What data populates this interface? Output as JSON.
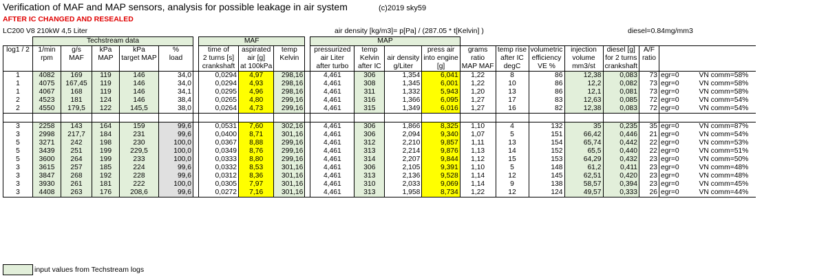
{
  "title": "Verification of MAF and MAP sensors, analysis for possible leakage in air system",
  "copyright": "(c)2019 sky59",
  "subtitle": "AFTER IC CHANGED AND RESEALED",
  "engine": "LC200 V8 210kW  4,5 Liter",
  "formula": "air density [kg/m3]= p[Pa] / (287.05 * t[Kelvin] )",
  "diesel_density": "diesel=0.84mg/mm3",
  "groups": {
    "techstream": "Techstream data",
    "maf": "MAF",
    "map": "MAP"
  },
  "headers_row1": [
    "log1 / 2",
    "1/min",
    "g/s",
    "kPa",
    "kPa",
    "%",
    "time of",
    "aspirated",
    "temp",
    "pressurized",
    "temp",
    "",
    "press air",
    "grams",
    "temp rise",
    "volumetric",
    "injection",
    "diesel [g]",
    "A/F"
  ],
  "headers_row2": [
    "",
    "rpm",
    "MAF",
    "MAP",
    "target MAP",
    "load",
    "2 turns [s]",
    "air [g]",
    "Kelvin",
    "air Liter",
    "Kelvin",
    "air density",
    "into engine",
    "ratio",
    "after IC",
    "efficiency",
    "volume",
    "for 2 turns",
    "ratio"
  ],
  "headers_row3": [
    "",
    "",
    "",
    "",
    "",
    "",
    "crankshaft",
    "at 100kPa",
    "",
    "after turbo",
    "after IC",
    "g/Liter",
    "[g]",
    "MAP MAF",
    "degC",
    "VE %",
    "mm3/st",
    "crankshaft",
    ""
  ],
  "rows_a": [
    [
      "1",
      "4082",
      "169",
      "119",
      "146",
      "34,0",
      "0,0294",
      "4,97",
      "298,16",
      "4,461",
      "306",
      "1,354",
      "6,041",
      "1,22",
      "8",
      "86",
      "12,38",
      "0,083",
      "73",
      "egr=0",
      "VN comm=58%"
    ],
    [
      "1",
      "4075",
      "167,45",
      "119",
      "146",
      "34,0",
      "0,0294",
      "4,93",
      "298,16",
      "4,461",
      "308",
      "1,345",
      "6,001",
      "1,22",
      "10",
      "86",
      "12,2",
      "0,082",
      "73",
      "egr=0",
      "VN comm=58%"
    ],
    [
      "1",
      "4067",
      "168",
      "119",
      "146",
      "34,1",
      "0,0295",
      "4,96",
      "298,16",
      "4,461",
      "311",
      "1,332",
      "5,943",
      "1,20",
      "13",
      "86",
      "12,1",
      "0,081",
      "73",
      "egr=0",
      "VN comm=58%"
    ],
    [
      "2",
      "4523",
      "181",
      "124",
      "146",
      "38,4",
      "0,0265",
      "4,80",
      "299,16",
      "4,461",
      "316",
      "1,366",
      "6,095",
      "1,27",
      "17",
      "83",
      "12,63",
      "0,085",
      "72",
      "egr=0",
      "VN comm=54%"
    ],
    [
      "2",
      "4550",
      "179,5",
      "122",
      "145,5",
      "38,0",
      "0,0264",
      "4,73",
      "299,16",
      "4,461",
      "315",
      "1,349",
      "6,016",
      "1,27",
      "16",
      "82",
      "12,38",
      "0,083",
      "72",
      "egr=0",
      "VN comm=54%"
    ]
  ],
  "rows_b": [
    [
      "3",
      "2258",
      "143",
      "164",
      "159",
      "99,6",
      "0,0531",
      "7,60",
      "302,16",
      "4,461",
      "306",
      "1,866",
      "8,325",
      "1,10",
      "4",
      "132",
      "35",
      "0,235",
      "35",
      "egr=0",
      "VN comm=87%"
    ],
    [
      "3",
      "2998",
      "217,7",
      "184",
      "231",
      "99,6",
      "0,0400",
      "8,71",
      "301,16",
      "4,461",
      "306",
      "2,094",
      "9,340",
      "1,07",
      "5",
      "151",
      "66,42",
      "0,446",
      "21",
      "egr=0",
      "VN comm=54%"
    ],
    [
      "5",
      "3271",
      "242",
      "198",
      "230",
      "100,0",
      "0,0367",
      "8,88",
      "299,16",
      "4,461",
      "312",
      "2,210",
      "9,857",
      "1,11",
      "13",
      "154",
      "65,74",
      "0,442",
      "22",
      "egr=0",
      "VN comm=53%"
    ],
    [
      "5",
      "3439",
      "251",
      "199",
      "229,5",
      "100,0",
      "0,0349",
      "8,76",
      "299,16",
      "4,461",
      "313",
      "2,214",
      "9,876",
      "1,13",
      "14",
      "152",
      "65,5",
      "0,440",
      "22",
      "egr=0",
      "VN comm=51%"
    ],
    [
      "5",
      "3600",
      "264",
      "199",
      "233",
      "100,0",
      "0,0333",
      "8,80",
      "299,16",
      "4,461",
      "314",
      "2,207",
      "9,844",
      "1,12",
      "15",
      "153",
      "64,29",
      "0,432",
      "23",
      "egr=0",
      "VN comm=50%"
    ],
    [
      "3",
      "3615",
      "257",
      "185",
      "224",
      "99,6",
      "0,0332",
      "8,53",
      "301,16",
      "4,461",
      "306",
      "2,105",
      "9,391",
      "1,10",
      "5",
      "148",
      "61,2",
      "0,411",
      "23",
      "egr=0",
      "VN comm=48%"
    ],
    [
      "3",
      "3847",
      "268",
      "192",
      "228",
      "99,6",
      "0,0312",
      "8,36",
      "301,16",
      "4,461",
      "313",
      "2,136",
      "9,528",
      "1,14",
      "12",
      "145",
      "62,51",
      "0,420",
      "23",
      "egr=0",
      "VN comm=48%"
    ],
    [
      "3",
      "3930",
      "261",
      "181",
      "222",
      "100,0",
      "0,0305",
      "7,97",
      "301,16",
      "4,461",
      "310",
      "2,033",
      "9,069",
      "1,14",
      "9",
      "138",
      "58,57",
      "0,394",
      "23",
      "egr=0",
      "VN comm=45%"
    ],
    [
      "3",
      "4408",
      "263",
      "176",
      "208,6",
      "99,6",
      "0,0272",
      "7,16",
      "301,16",
      "4,461",
      "313",
      "1,958",
      "8,734",
      "1,22",
      "12",
      "124",
      "49,57",
      "0,333",
      "26",
      "egr=0",
      "VN comm=44%"
    ]
  ],
  "legend": "input values from Techstream logs",
  "colors": {
    "green": "#e2efda",
    "yellow": "#ffff00",
    "grey": "#e0e0e0",
    "red": "#e00000"
  }
}
